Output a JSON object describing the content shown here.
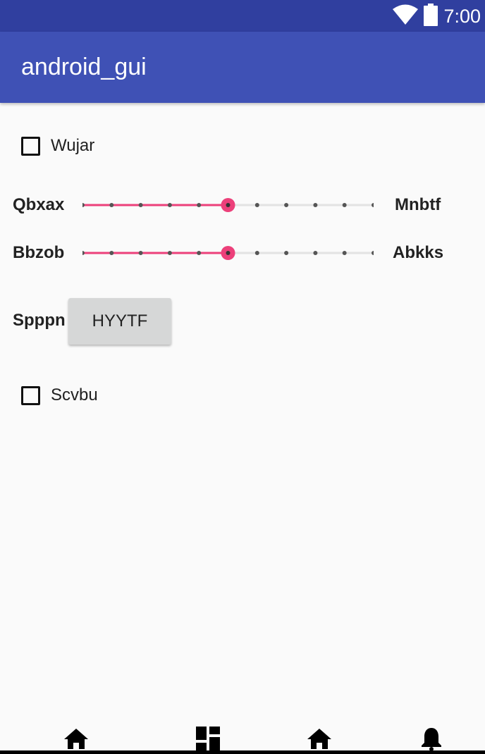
{
  "status_bar": {
    "time": "7:00",
    "icons": [
      "wifi-icon",
      "battery-icon"
    ]
  },
  "app_bar": {
    "title": "android_gui"
  },
  "checkboxes": [
    {
      "label": "Wujar",
      "checked": false
    },
    {
      "label": "Scvbu",
      "checked": false
    }
  ],
  "seekbars": [
    {
      "left_label": "Qbxax",
      "right_label": "Mnbtf",
      "steps": 10,
      "value": 5
    },
    {
      "left_label": "Bbzob",
      "right_label": "Abkks",
      "steps": 10,
      "value": 5
    }
  ],
  "spinner_row": {
    "label": "Spppn",
    "button_label": "HYYTF"
  },
  "bottom_nav": {
    "icons": [
      "home-icon",
      "dashboard-icon",
      "home-icon",
      "notifications-icon"
    ]
  },
  "colors": {
    "status_bar": "#303f9f",
    "app_bar": "#3f51b5",
    "accent": "#ec407a",
    "background": "#fafafa"
  }
}
